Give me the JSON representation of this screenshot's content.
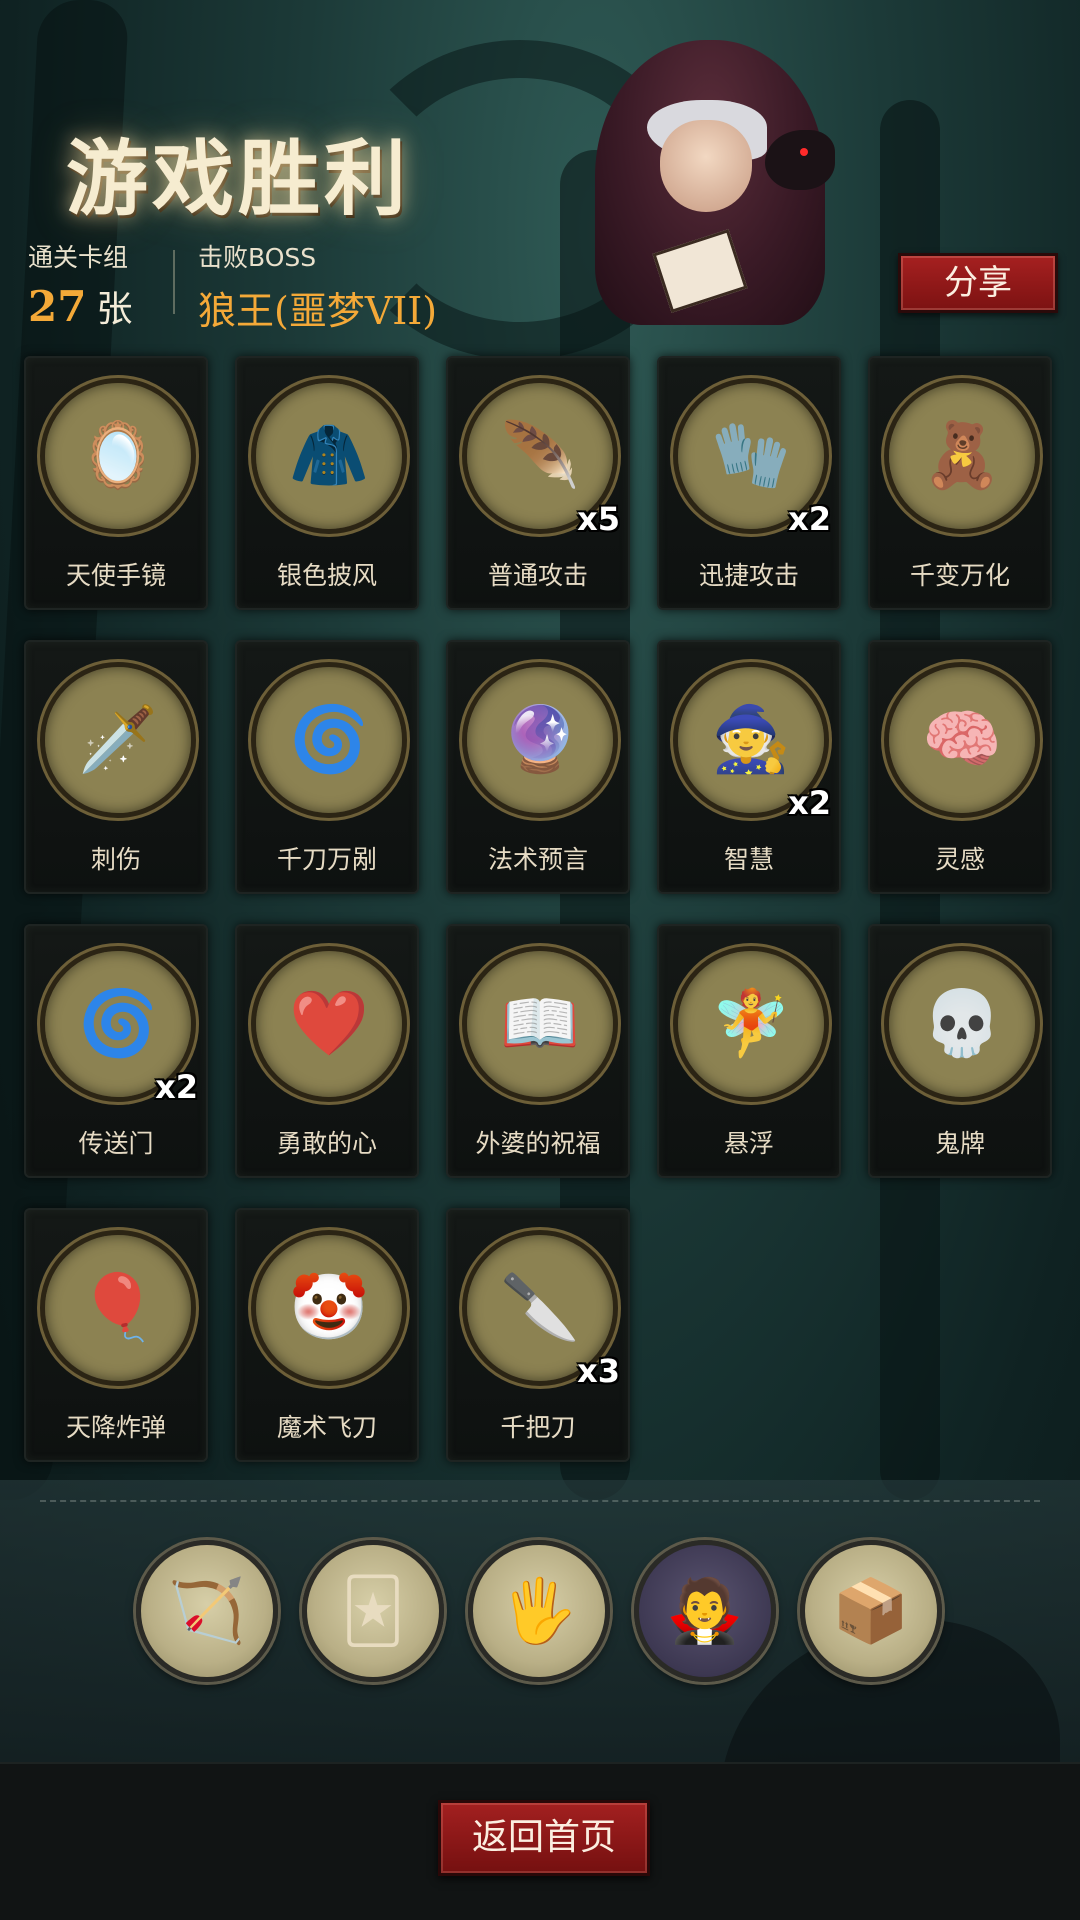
{
  "header": {
    "title": "游戏胜利",
    "stats": {
      "cards_label": "通关卡组",
      "cards_count": "27",
      "cards_unit": "张",
      "boss_label": "击败BOSS",
      "boss_name": "狼王(噩梦VII)"
    },
    "share_label": "分享"
  },
  "cards": [
    {
      "name": "天使手镜",
      "icon": "mirror-icon",
      "art": "🪞",
      "count": ""
    },
    {
      "name": "银色披风",
      "icon": "cloak-icon",
      "art": "🧥",
      "count": ""
    },
    {
      "name": "普通攻击",
      "icon": "feather-slash-icon",
      "art": "🪶",
      "count": "x5"
    },
    {
      "name": "迅捷攻击",
      "icon": "gauntlet-icon",
      "art": "🧤",
      "count": "x2"
    },
    {
      "name": "千变万化",
      "icon": "puppets-icon",
      "art": "🧸",
      "count": ""
    },
    {
      "name": "刺伤",
      "icon": "dagger-icon",
      "art": "🗡️",
      "count": ""
    },
    {
      "name": "千刀万剐",
      "icon": "blade-storm-icon",
      "art": "🌀",
      "count": ""
    },
    {
      "name": "法术预言",
      "icon": "crystal-ball-icon",
      "art": "🔮",
      "count": ""
    },
    {
      "name": "智慧",
      "icon": "sage-icon",
      "art": "🧙",
      "count": "x2"
    },
    {
      "name": "灵感",
      "icon": "brain-skull-icon",
      "art": "🧠",
      "count": ""
    },
    {
      "name": "传送门",
      "icon": "portal-icon",
      "art": "🌀",
      "count": "x2"
    },
    {
      "name": "勇敢的心",
      "icon": "brave-heart-icon",
      "art": "❤️",
      "count": ""
    },
    {
      "name": "外婆的祝福",
      "icon": "grandma-book-icon",
      "art": "📖",
      "count": ""
    },
    {
      "name": "悬浮",
      "icon": "levitate-icon",
      "art": "🧚",
      "count": ""
    },
    {
      "name": "鬼牌",
      "icon": "skull-card-icon",
      "art": "💀",
      "count": ""
    },
    {
      "name": "天降炸弹",
      "icon": "balloon-bomb-icon",
      "art": "🎈",
      "count": ""
    },
    {
      "name": "魔术飞刀",
      "icon": "clown-icon",
      "art": "🤡",
      "count": ""
    },
    {
      "name": "千把刀",
      "icon": "knives-icon",
      "art": "🔪",
      "count": "x3"
    }
  ],
  "relics": [
    {
      "icon": "crossbow-arm-icon",
      "art": "🏹",
      "dark": false
    },
    {
      "icon": "red-card-icon",
      "art": "🃏",
      "dark": false
    },
    {
      "icon": "hand-cards-icon",
      "art": "🖐️",
      "dark": false
    },
    {
      "icon": "vampire-icon",
      "art": "🧛",
      "dark": true
    },
    {
      "icon": "mystery-box-icon",
      "art": "📦",
      "dark": false
    }
  ],
  "footer": {
    "home_label": "返回首页"
  }
}
